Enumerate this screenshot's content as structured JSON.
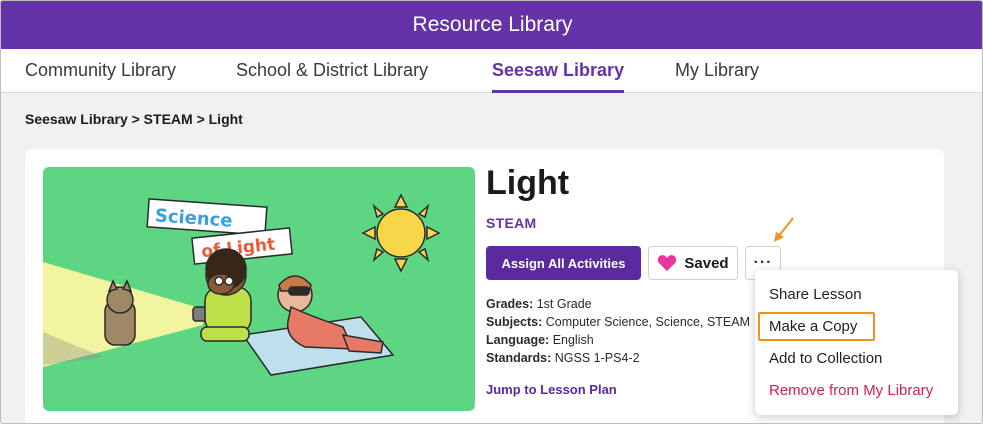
{
  "header": {
    "title": "Resource Library"
  },
  "tabs": [
    {
      "label": "Community Library"
    },
    {
      "label": "School & District Library"
    },
    {
      "label": "Seesaw Library"
    },
    {
      "label": "My Library"
    }
  ],
  "breadcrumb": "Seesaw Library > STEAM > Light",
  "lesson": {
    "title": "Light",
    "category": "STEAM",
    "assign_label": "Assign All Activities",
    "saved_label": "Saved",
    "more_label": "···",
    "thumbnail_text_1": "Science",
    "thumbnail_text_2": "of Light",
    "meta": {
      "grades_label": "Grades:",
      "grades": "1st Grade",
      "subjects_label": "Subjects:",
      "subjects": "Computer Science, Science, STEAM",
      "language_label": "Language:",
      "language": "English",
      "standards_label": "Standards:",
      "standards": "NGSS 1-PS4-2"
    },
    "jump_link": "Jump to Lesson Plan"
  },
  "menu": {
    "items": [
      {
        "label": "Share Lesson"
      },
      {
        "label": "Make a Copy"
      },
      {
        "label": "Add to Collection"
      },
      {
        "label": "Remove from My Library"
      }
    ]
  },
  "colors": {
    "brand_purple": "#6533a8",
    "highlight_orange": "#f4901e",
    "danger_red": "#d0224f",
    "heart_pink": "#e8399a",
    "thumbnail_green": "#5dd583"
  },
  "icons": [
    "heart-icon",
    "more-icon",
    "annotation-arrow"
  ]
}
